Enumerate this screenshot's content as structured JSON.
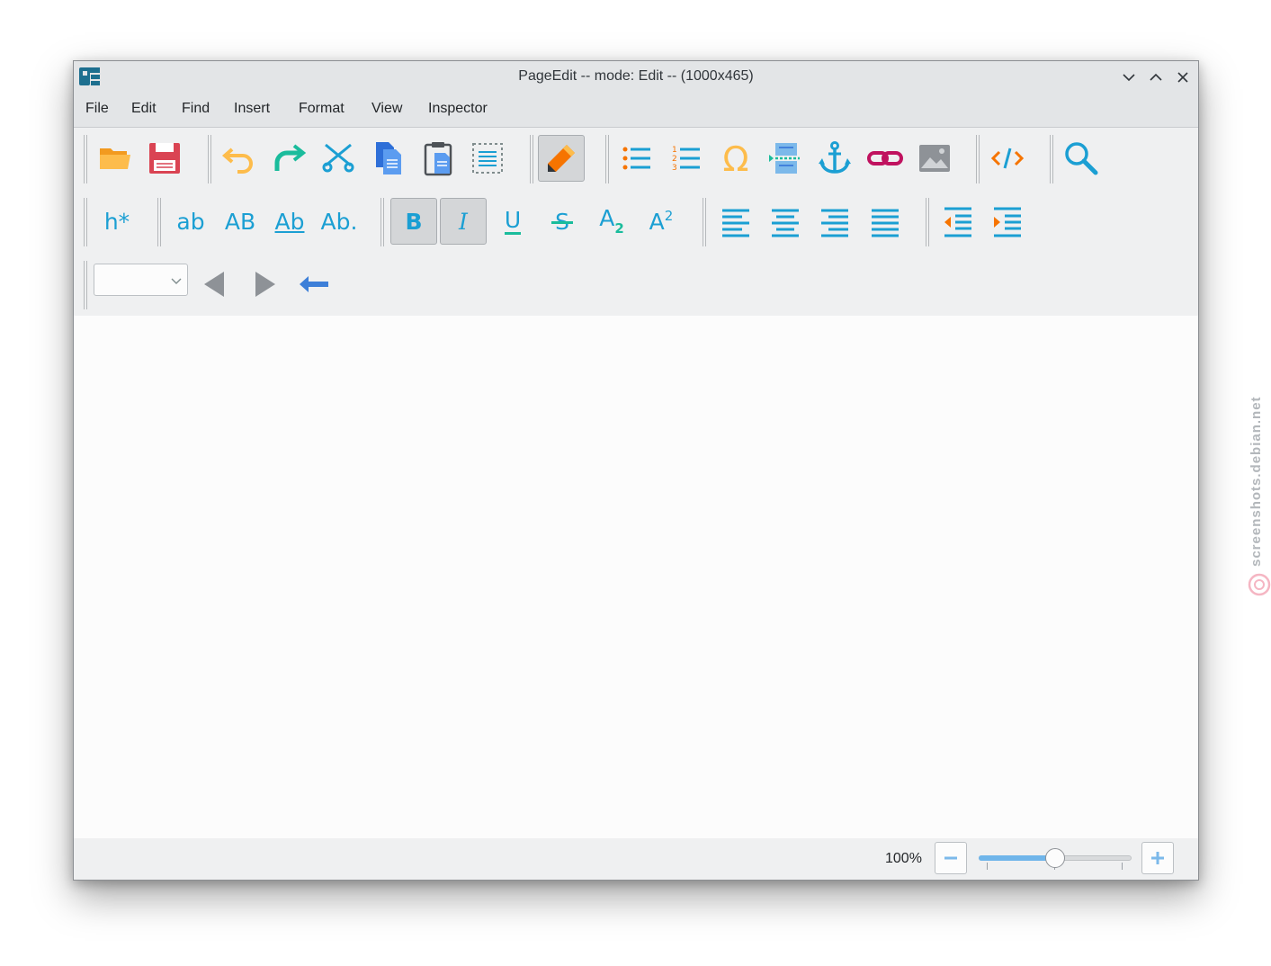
{
  "window": {
    "title": "PageEdit -- mode: Edit -- (1000x465)"
  },
  "menu": [
    "File",
    "Edit",
    "Find",
    "Insert",
    "Format",
    "View",
    "Inspector"
  ],
  "toolbar1": [
    {
      "name": "open-folder-icon",
      "icon": "folder-open"
    },
    {
      "name": "save-icon",
      "icon": "floppy-disk"
    },
    {
      "name": "undo-icon",
      "icon": "undo-arrow"
    },
    {
      "name": "redo-icon",
      "icon": "redo-arrow"
    },
    {
      "name": "cut-icon",
      "icon": "scissors"
    },
    {
      "name": "copy-icon",
      "icon": "copy-pages"
    },
    {
      "name": "paste-icon",
      "icon": "clipboard"
    },
    {
      "name": "select-all-icon",
      "icon": "dashed-selection"
    },
    {
      "name": "edit-mode-icon",
      "icon": "pencil",
      "pressed": true
    },
    {
      "name": "bullet-list-icon",
      "icon": "bullet-list"
    },
    {
      "name": "numbered-list-icon",
      "icon": "numbered-list"
    },
    {
      "name": "special-character-icon",
      "icon": "omega"
    },
    {
      "name": "insert-file-icon",
      "icon": "insert-file"
    },
    {
      "name": "anchor-icon",
      "icon": "anchor"
    },
    {
      "name": "link-icon",
      "icon": "chain-link"
    },
    {
      "name": "image-icon",
      "icon": "picture"
    },
    {
      "name": "code-view-icon",
      "icon": "code-brackets"
    },
    {
      "name": "find-icon",
      "icon": "magnifier"
    }
  ],
  "toolbar2": {
    "heading": "h*",
    "lowercase": "ab",
    "uppercase": "AB",
    "titlecase": "Ab",
    "sentencecase": "Ab.",
    "bold": "B",
    "italic": "I",
    "underline": "U",
    "strike": "S",
    "subscript_base": "A",
    "subscript_sub": "2",
    "superscript_base": "A",
    "superscript_sup": "2"
  },
  "toolbar3": {
    "combo_value": ""
  },
  "status": {
    "zoom_label": "100%",
    "zoom_level": 0.5
  },
  "watermark": "screenshots.debian.net",
  "colors": {
    "accent_blue": "#1b9fd3",
    "orange": "#f67400",
    "yellow": "#fdbc4b",
    "green": "#1abc9c",
    "red": "#da4453",
    "crimson": "#c0125f"
  }
}
